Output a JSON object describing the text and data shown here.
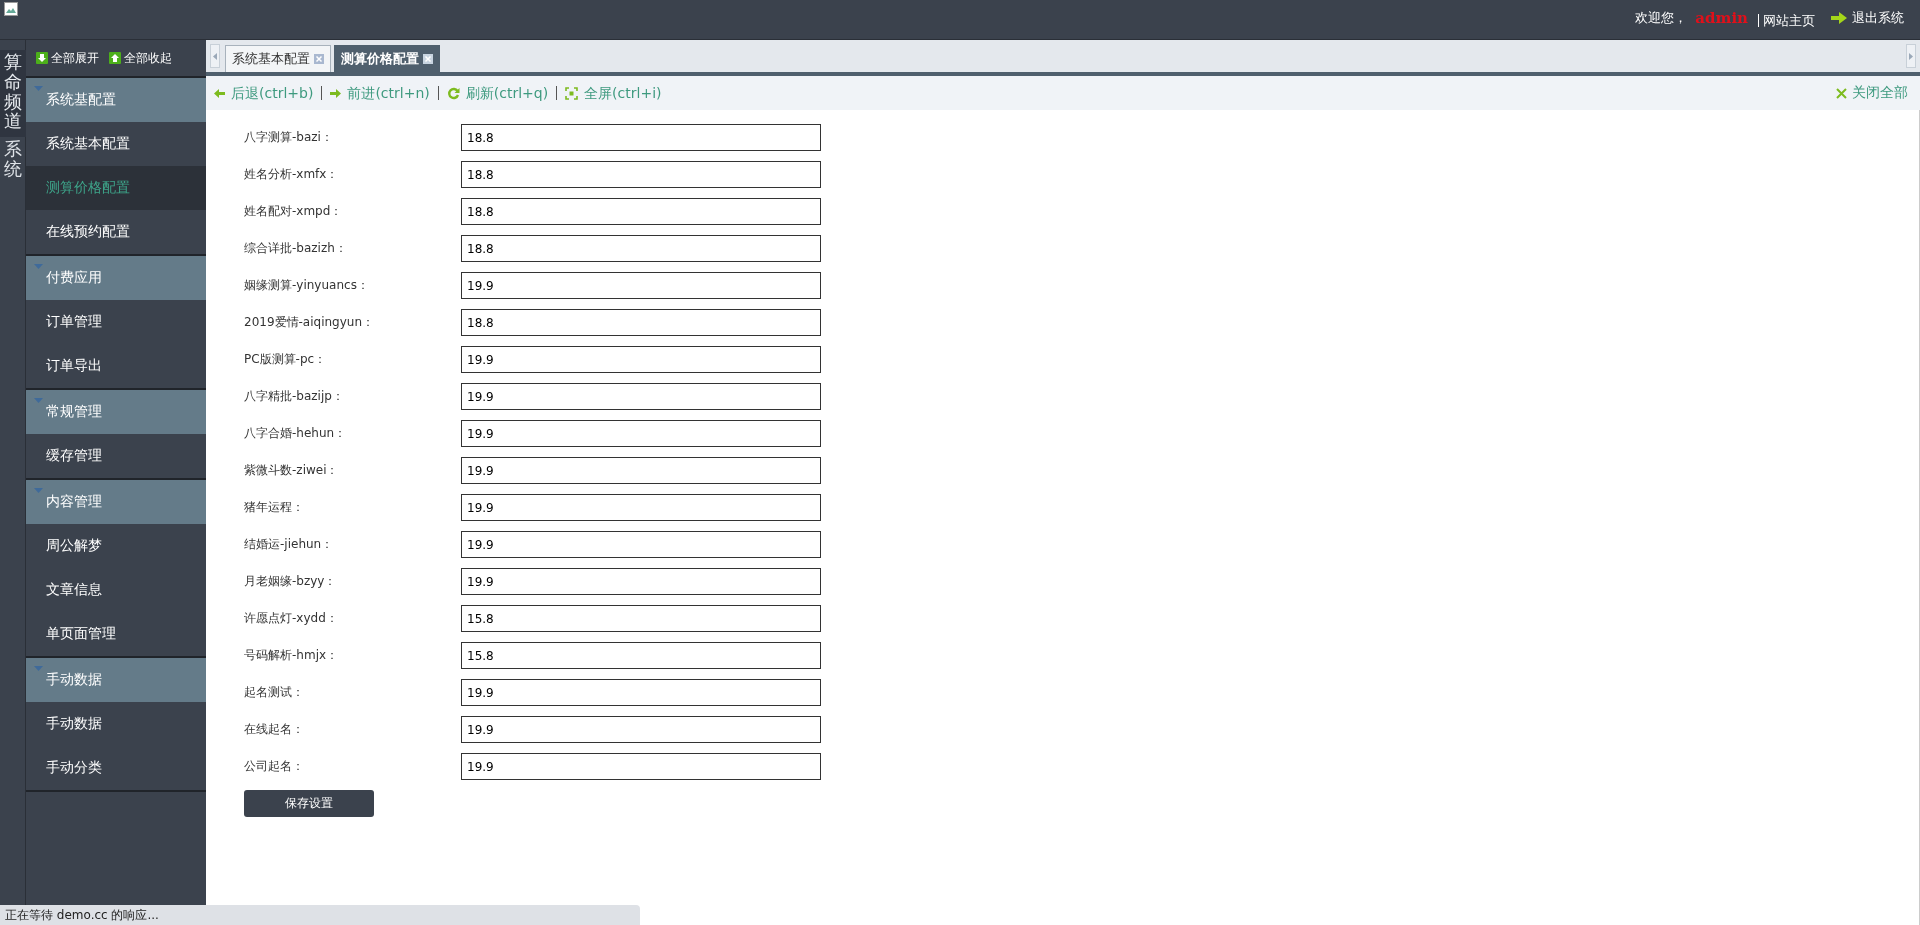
{
  "header": {
    "welcome": "欢迎您，",
    "user": "admin",
    "links": [
      {
        "label": "网站主页",
        "kind": "home"
      },
      {
        "label": "退出系统",
        "kind": "exit"
      }
    ]
  },
  "channels": [
    {
      "label": "算命频道",
      "selected": true
    },
    {
      "label": "系统",
      "selected": false
    }
  ],
  "sidebar": {
    "tools": [
      {
        "label": "全部展开",
        "kind": "expand"
      },
      {
        "label": "全部收起",
        "kind": "collapse"
      }
    ],
    "groups": [
      {
        "label": "系统基配置",
        "expanded": true,
        "children": [
          {
            "label": "系统基本配置",
            "selected": false
          },
          {
            "label": "测算价格配置",
            "selected": true
          },
          {
            "label": "在线预约配置",
            "selected": false
          }
        ]
      },
      {
        "label": "付费应用",
        "expanded": true,
        "children": [
          {
            "label": "订单管理",
            "selected": false
          },
          {
            "label": "订单导出",
            "selected": false
          }
        ]
      },
      {
        "label": "常规管理",
        "expanded": true,
        "children": [
          {
            "label": "缓存管理",
            "selected": false
          }
        ]
      },
      {
        "label": "内容管理",
        "expanded": true,
        "children": [
          {
            "label": "周公解梦",
            "selected": false
          },
          {
            "label": "文章信息",
            "selected": false
          },
          {
            "label": "单页面管理",
            "selected": false
          }
        ]
      },
      {
        "label": "手动数据",
        "expanded": true,
        "children": [
          {
            "label": "手动数据",
            "selected": false
          },
          {
            "label": "手动分类",
            "selected": false
          }
        ]
      }
    ]
  },
  "tabs": [
    {
      "label": "系统基本配置",
      "selected": false
    },
    {
      "label": "测算价格配置",
      "selected": true
    }
  ],
  "toolbar": {
    "actions": [
      {
        "label": "后退(ctrl+b)",
        "kind": "back"
      },
      {
        "label": "前进(ctrl+n)",
        "kind": "forward"
      },
      {
        "label": "刷新(ctrl+q)",
        "kind": "refresh"
      },
      {
        "label": "全屏(ctrl+i)",
        "kind": "fullscreen"
      }
    ],
    "close_all": "关闭全部"
  },
  "form": {
    "fields": [
      {
        "label": "八字测算-bazi：",
        "value": "18.8"
      },
      {
        "label": "姓名分析-xmfx：",
        "value": "18.8"
      },
      {
        "label": "姓名配对-xmpd：",
        "value": "18.8"
      },
      {
        "label": "综合详批-bazizh：",
        "value": "18.8"
      },
      {
        "label": "姻缘测算-yinyuancs：",
        "value": "19.9"
      },
      {
        "label": "2019爱情-aiqingyun：",
        "value": "18.8"
      },
      {
        "label": "PC版测算-pc：",
        "value": "19.9"
      },
      {
        "label": "八字精批-bazijp：",
        "value": "19.9"
      },
      {
        "label": "八字合婚-hehun：",
        "value": "19.9"
      },
      {
        "label": "紫微斗数-ziwei：",
        "value": "19.9"
      },
      {
        "label": "猪年运程：",
        "value": "19.9"
      },
      {
        "label": "结婚运-jiehun：",
        "value": "19.9"
      },
      {
        "label": "月老姻缘-bzyy：",
        "value": "19.9"
      },
      {
        "label": "许愿点灯-xydd：",
        "value": "15.8"
      },
      {
        "label": "号码解析-hmjx：",
        "value": "15.8"
      },
      {
        "label": "起名测试：",
        "value": "19.9"
      },
      {
        "label": "在线起名：",
        "value": "19.9"
      },
      {
        "label": "公司起名：",
        "value": "19.9"
      }
    ],
    "submit": "保存设置"
  },
  "status_bar": "正在等待 demo.cc 的响应..."
}
